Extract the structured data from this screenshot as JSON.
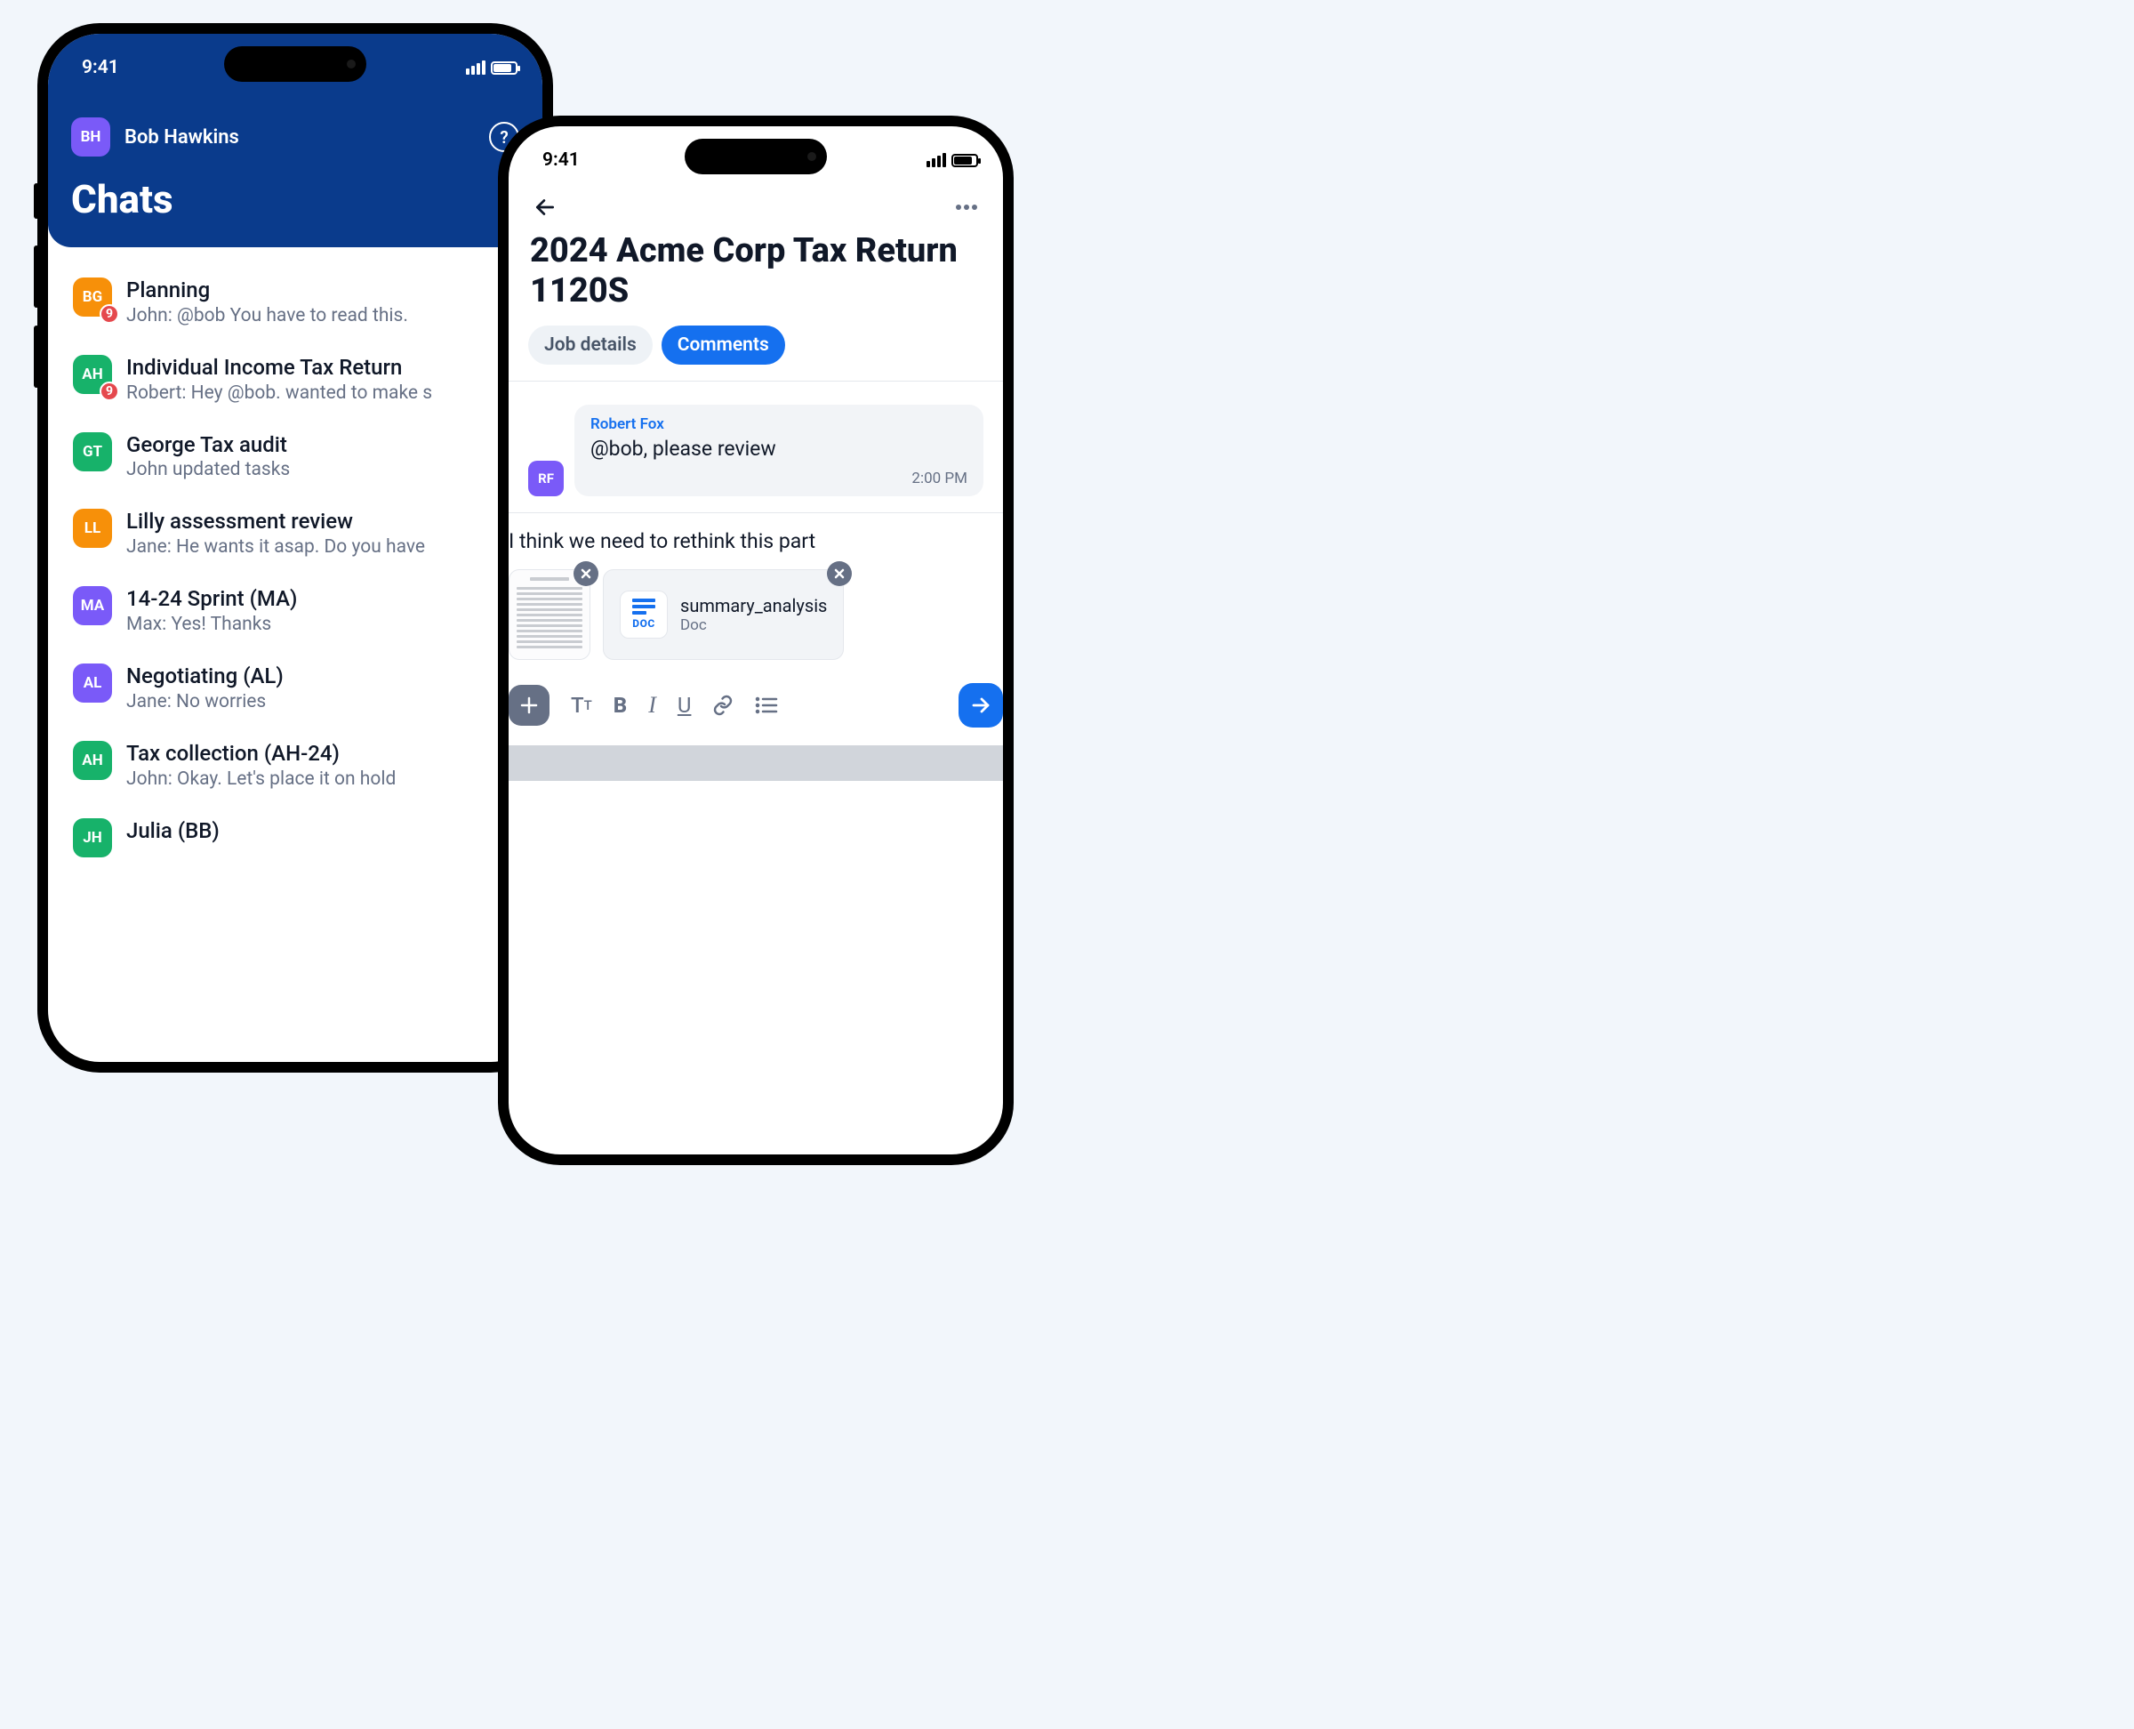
{
  "status": {
    "time": "9:41"
  },
  "colors": {
    "primary": "#1570ef",
    "header": "#0a3b8c",
    "orange": "#f79009",
    "green": "#17b26a",
    "violet": "#7a5af8",
    "red": "#e5484d",
    "text_muted": "#667085"
  },
  "left": {
    "owner": {
      "initials": "BH",
      "name": "Bob Hawkins"
    },
    "title": "Chats",
    "items": [
      {
        "initials": "BG",
        "color": "orange",
        "title": "Planning",
        "preview": "John: @bob You have to read this.",
        "unread": "9"
      },
      {
        "initials": "AH",
        "color": "green",
        "title": "Individual Income Tax Return",
        "preview": "Robert: Hey @bob. wanted to make s",
        "unread": "9"
      },
      {
        "initials": "GT",
        "color": "green",
        "title": "George Tax audit",
        "preview": "John updated tasks"
      },
      {
        "initials": "LL",
        "color": "orange",
        "title": "Lilly assessment review",
        "preview": "Jane: He wants it asap. Do you have"
      },
      {
        "initials": "MA",
        "color": "violet",
        "title": "14-24 Sprint (MA)",
        "preview": "Max: Yes! Thanks"
      },
      {
        "initials": "AL",
        "color": "violet",
        "title": "Negotiating (AL)",
        "preview": "Jane: No worries"
      },
      {
        "initials": "AH",
        "color": "green",
        "title": "Tax collection (AH-24)",
        "preview": "John: Okay. Let's place it on hold"
      },
      {
        "initials": "JH",
        "color": "green",
        "title": "Julia (BB)",
        "preview": ""
      }
    ]
  },
  "right": {
    "title": "2024 Acme Corp Tax Return 1120S",
    "tabs": {
      "details": "Job details",
      "comments": "Comments"
    },
    "comment": {
      "avatar_initials": "RF",
      "author": "Robert Fox",
      "text": "@bob, please review",
      "time": "2:00 PM"
    },
    "composer": {
      "text": "I think we need to rethink this part",
      "file": {
        "name": "summary_analysis",
        "type": "Doc",
        "badge": "DOC"
      }
    }
  }
}
